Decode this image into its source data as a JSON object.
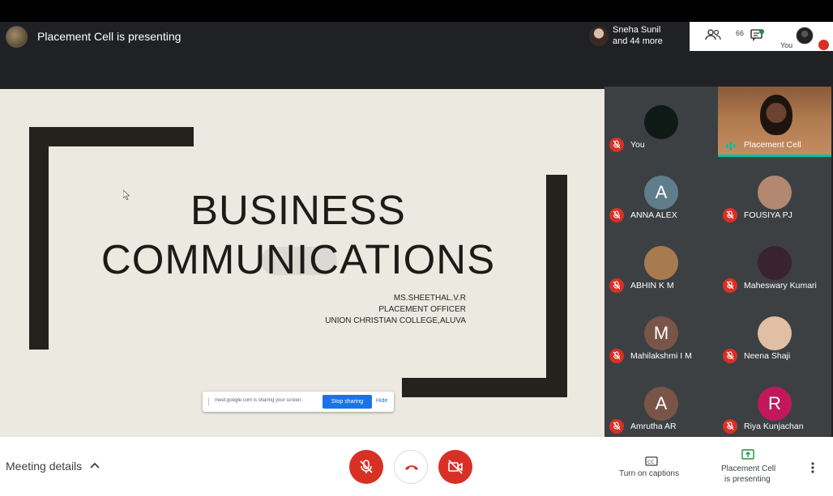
{
  "header": {
    "presenting_title": "Placement Cell is presenting",
    "participants_chip": {
      "name": "Sneha Sunil",
      "more": "and 44 more"
    },
    "people_count": "66",
    "self_label": "You"
  },
  "slide": {
    "title_line1": "BUSINESS",
    "title_line2": "COMMUNICATIONS",
    "presenter_name": "MS.SHEETHAL.V.R",
    "presenter_role": "PLACEMENT OFFICER",
    "institution": "UNION CHRISTIAN COLLEGE,ALUVA",
    "share_bar": {
      "message": "meet.google.com is sharing your screen.",
      "stop_label": "Stop sharing",
      "hide_label": "Hide"
    }
  },
  "participants": [
    {
      "name": "You",
      "avatar": "",
      "color": "#0f1a16",
      "muted": true
    },
    {
      "name": "Placement Cell",
      "avatar": "",
      "color": "#b07a4f",
      "muted": false,
      "speaking": true
    },
    {
      "name": "ANNA ALEX",
      "avatar": "A",
      "color": "#607d8b",
      "muted": true
    },
    {
      "name": "FOUSIYA PJ",
      "avatar": "",
      "color": "#b28870",
      "muted": true
    },
    {
      "name": "ABHIN K M",
      "avatar": "",
      "color": "#a87a50",
      "muted": true
    },
    {
      "name": "Maheswary Kumari",
      "avatar": "",
      "color": "#3a2230",
      "muted": true
    },
    {
      "name": "Mahilakshmi I M",
      "avatar": "M",
      "color": "#795548",
      "muted": true
    },
    {
      "name": "Neena Shaji",
      "avatar": "",
      "color": "#e0bfa4",
      "muted": true
    },
    {
      "name": "Amrutha AR",
      "avatar": "A",
      "color": "#795548",
      "muted": true
    },
    {
      "name": "Riya Kunjachan",
      "avatar": "R",
      "color": "#c2185b",
      "muted": true
    }
  ],
  "footer": {
    "meeting_details": "Meeting details",
    "captions_label": "Turn on captions",
    "present_line1": "Placement Cell",
    "present_line2": "is presenting"
  },
  "icons": {
    "mic": "mic-off-icon",
    "end_call": "end-call-icon",
    "camera": "videocam-off-icon",
    "captions": "closed-captions-icon",
    "present": "present-screen-icon",
    "more": "more-vert-icon",
    "people": "people-icon",
    "chat": "chat-icon"
  },
  "colors": {
    "accent_red": "#d93025",
    "accent_blue": "#1a73e8",
    "speaking_teal": "#00bfa5"
  }
}
